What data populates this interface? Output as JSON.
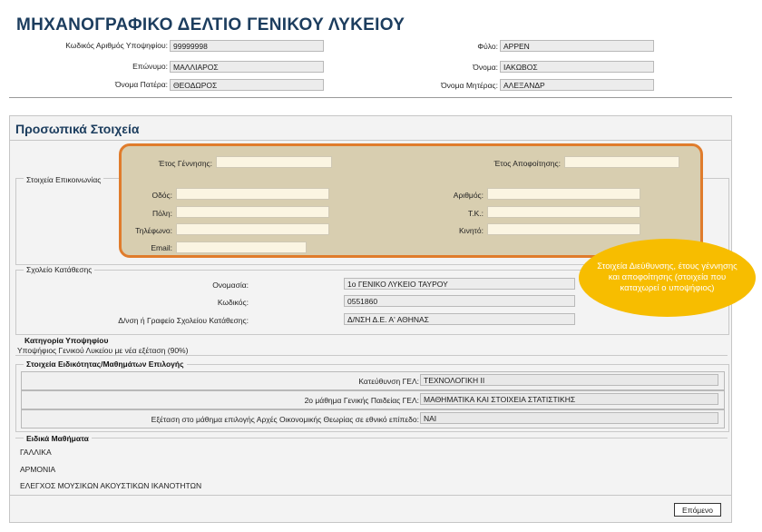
{
  "title": "ΜΗΧΑΝΟΓΡΑΦΙΚΟ ΔΕΛΤΙΟ ΓΕΝΙΚΟΥ ΛΥΚΕΙΟΥ",
  "header": {
    "reg_label": "Κωδικός Αριθμός Υποψηφίου:",
    "reg_value": "99999998",
    "surname_label": "Επώνυμο:",
    "surname_value": "ΜΑΛΛΙΑΡΟΣ",
    "father_label": "Όνομα Πατέρα:",
    "father_value": "ΘΕΟΔΩΡΟΣ",
    "gender_label": "Φύλο:",
    "gender_value": "ΑΡΡΕΝ",
    "name_label": "Όνομα:",
    "name_value": "ΙΑΚΩΒΟΣ",
    "mother_label": "Όνομα Μητέρας:",
    "mother_value": "ΑΛΕΞΑΝΔΡ"
  },
  "personal": {
    "heading": "Προσωπικά Στοιχεία",
    "birth_year_label": "Έτος Γέννησης:",
    "birth_year_value": "",
    "grad_year_label": "Έτος Αποφοίτησης:",
    "grad_year_value": "",
    "contact_heading": "Στοιχεία Επικοινωνίας",
    "street_label": "Οδός:",
    "street_value": "",
    "number_label": "Αριθμός:",
    "number_value": "",
    "city_label": "Πόλη:",
    "city_value": "",
    "zip_label": "Τ.Κ.:",
    "zip_value": "",
    "phone_label": "Τηλέφωνο:",
    "phone_value": "",
    "mobile_label": "Κινητό:",
    "mobile_value": "",
    "email_label": "Email:",
    "email_value": ""
  },
  "callout": "Στοιχεία Διεύθυνσης, έτους γέννησης και αποφοίτησης (στοιχεία που καταχωρεί ο υποψήφιος)",
  "school": {
    "heading": "Σχολείο Κατάθεσης",
    "name_label": "Ονομασία:",
    "name_value": "1ο  ΓΕΝΙΚΟ ΛΥΚΕΙΟ ΤΑΥΡΟΥ",
    "code_label": "Κωδικός:",
    "code_value": "0551860",
    "dir_label": "Δ/νση ή Γραφείο Σχολείου Κατάθεσης:",
    "dir_value": "Δ/ΝΣΗ Δ.Ε. Α' ΑΘΗΝΑΣ"
  },
  "category": {
    "heading": "Κατηγορία Υποψηφίου",
    "value": "Υποψήφιος Γενικού Λυκείου με νέα εξέταση (90%)"
  },
  "specialty": {
    "heading": "Στοιχεία Ειδικότητας/Μαθημάτων Επιλογής",
    "rows": [
      {
        "label": "Κατεύθυνση ΓΕΛ:",
        "value": "ΤΕΧΝΟΛΟΓΙΚΗ ΙΙ"
      },
      {
        "label": "2ο μάθημα Γενικής Παιδείας ΓΕΛ:",
        "value": "ΜΑΘΗΜΑΤΙΚΑ ΚΑΙ ΣΤΟΙΧΕΙΑ ΣΤΑΤΙΣΤΙΚΗΣ"
      },
      {
        "label": "Εξέταση στο μάθημα επιλογής Αρχές Οικονομικής Θεωρίας σε εθνικό επίπεδο:",
        "value": "ΝΑΙ"
      }
    ]
  },
  "special": {
    "heading": "Ειδικά Μαθήματα",
    "items": [
      "ΓΑΛΛΙΚΑ",
      "ΑΡΜΟΝΙΑ",
      "ΕΛΕΓΧΟΣ ΜΟΥΣΙΚΩΝ ΑΚΟΥΣΤΙΚΩΝ ΙΚΑΝΟΤΗΤΩΝ"
    ]
  },
  "next_button": "Επόμενο"
}
